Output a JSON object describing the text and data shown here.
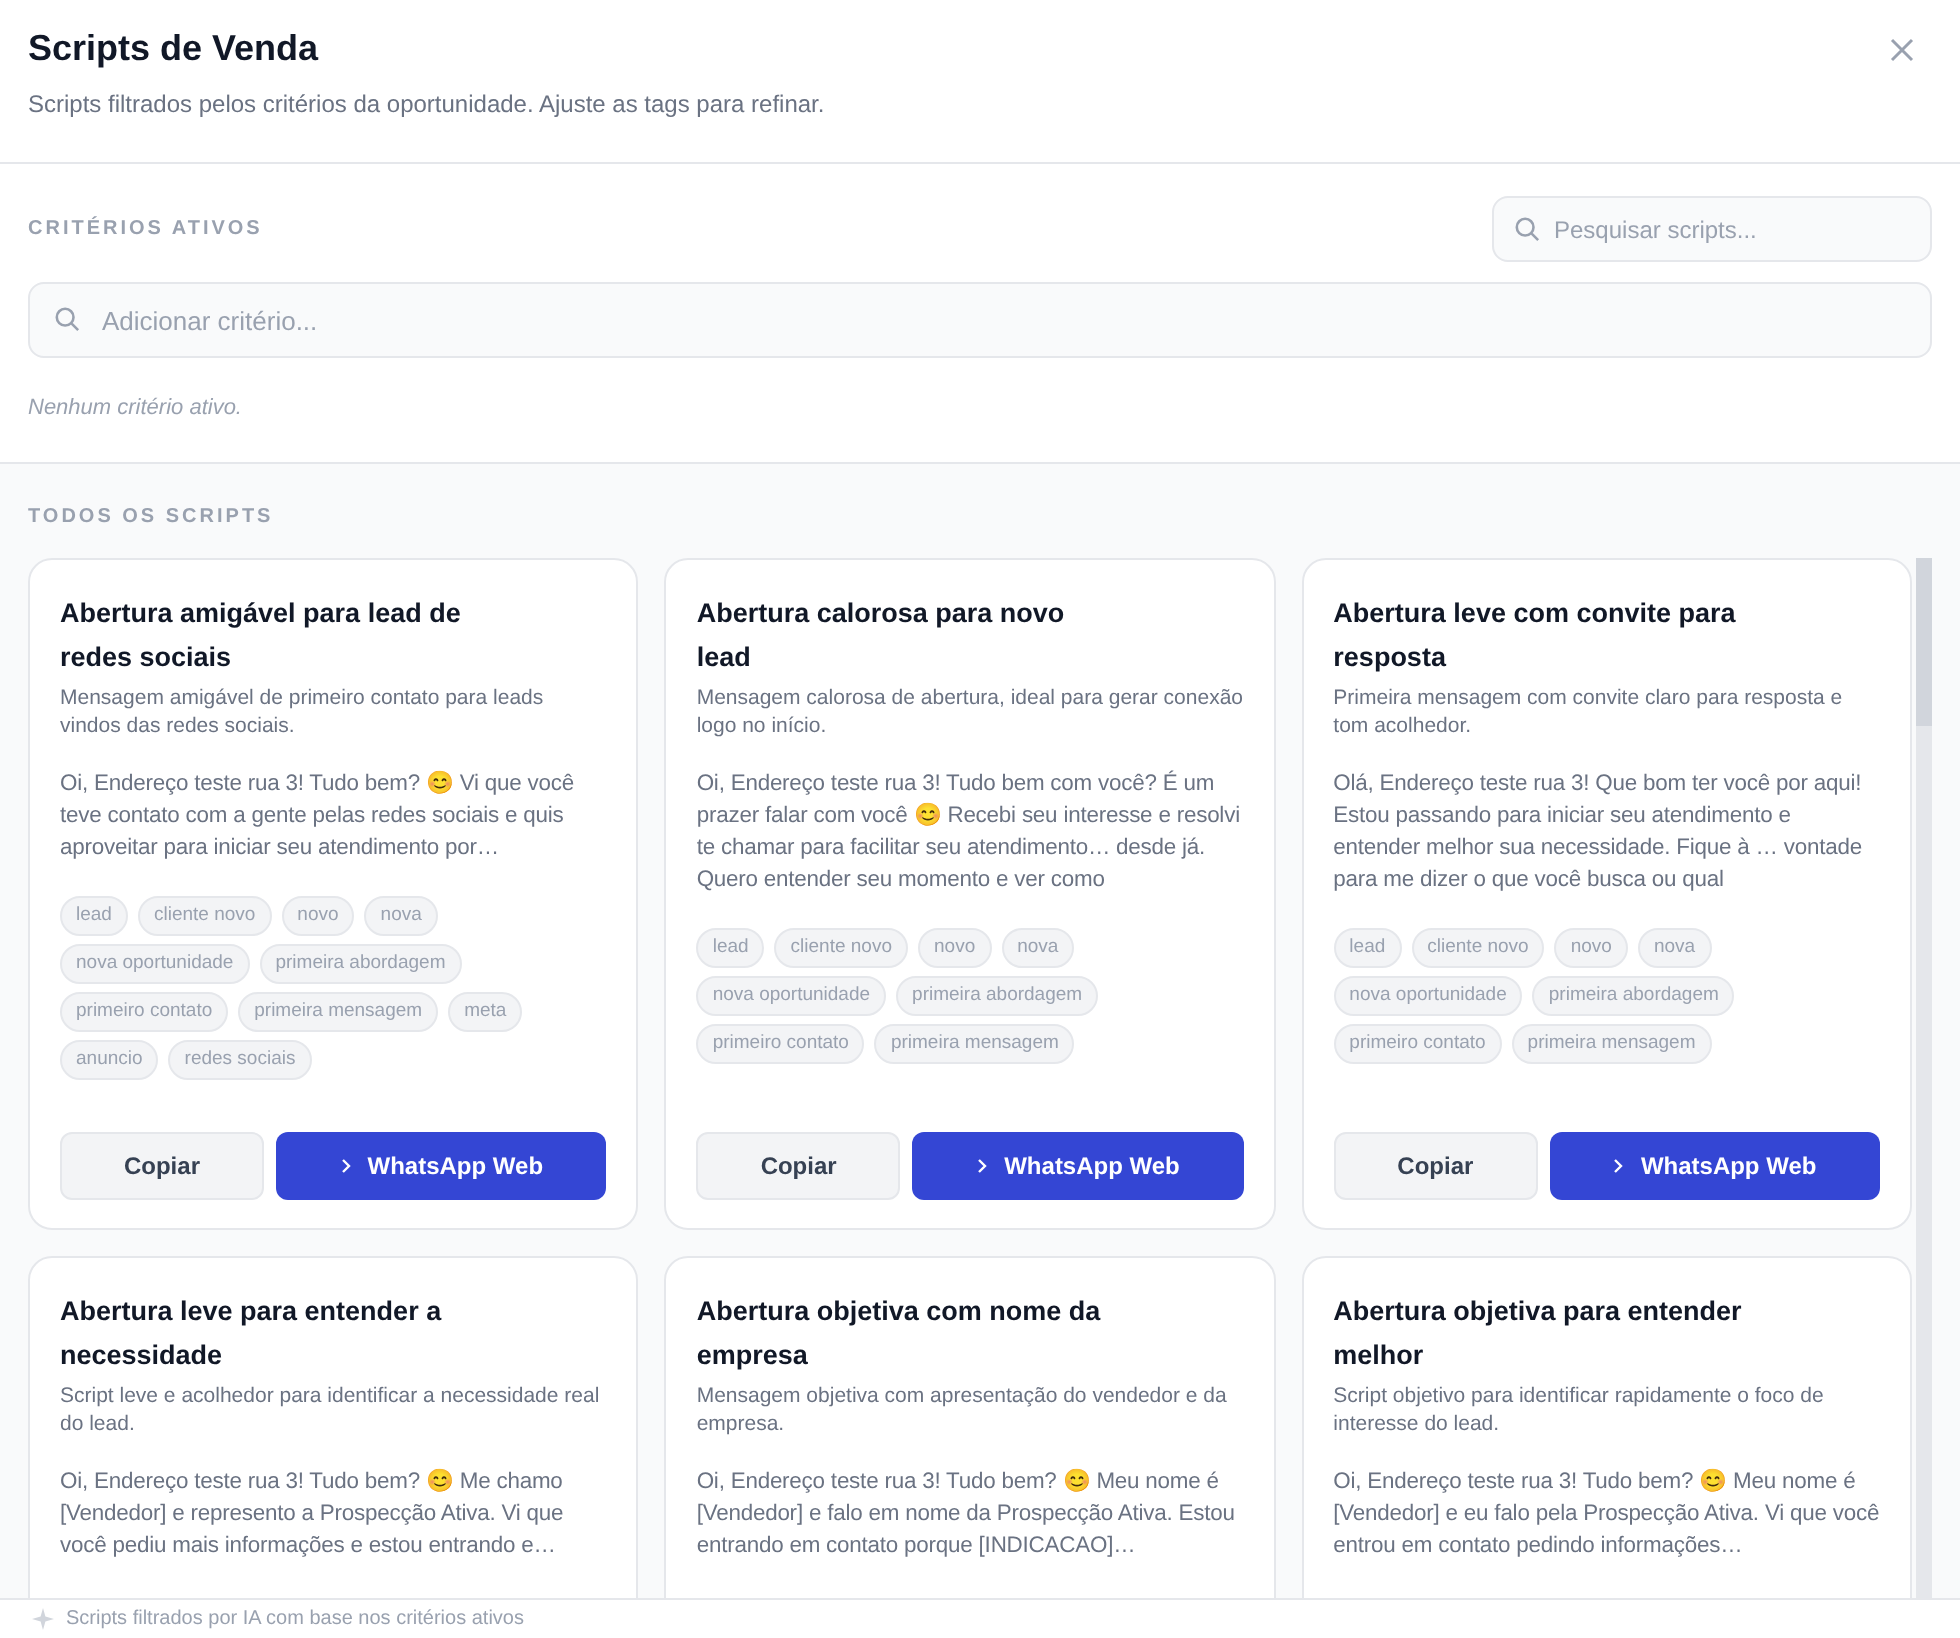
{
  "dialog": {
    "title": "Scripts de Venda",
    "subtitle": "Scripts filtrados pelos critérios da oportunidade. Ajuste as tags para refinar."
  },
  "criteria": {
    "heading": "CRITÉRIOS ATIVOS",
    "search_placeholder": "Pesquisar scripts...",
    "add_placeholder": "Adicionar critério...",
    "empty_text": "Nenhum critério ativo."
  },
  "scripts_heading": "TODOS OS SCRIPTS",
  "scripts": [
    {
      "title": "Abertura amigável para lead de redes sociais",
      "description": "Mensagem amigável de primeiro contato para leads vindos das redes sociais.",
      "message": "Oi, Endereço teste rua 3! Tudo bem? 😊 Vi que você teve contato com a gente pelas redes sociais e quis aproveitar para iniciar seu atendimento por…",
      "tags": [
        "lead",
        "cliente novo",
        "novo",
        "nova",
        "nova oportunidade",
        "primeira abordagem",
        "primeiro contato",
        "primeira mensagem",
        "meta",
        "anuncio",
        "redes sociais"
      ],
      "copy_label": "Copiar",
      "whatsapp_label": "WhatsApp Web"
    },
    {
      "title": "Abertura calorosa para novo lead",
      "description": "Mensagem calorosa de abertura, ideal para gerar conexão logo no início.",
      "message": "Oi, Endereço teste rua 3! Tudo bem com você? É um prazer falar com você 😊 Recebi seu interesse e resolvi te chamar para facilitar seu atendimento… desde já. Quero entender seu momento e ver como",
      "tags": [
        "lead",
        "cliente novo",
        "novo",
        "nova",
        "nova oportunidade",
        "primeira abordagem",
        "primeiro contato",
        "primeira mensagem"
      ],
      "copy_label": "Copiar",
      "whatsapp_label": "WhatsApp Web"
    },
    {
      "title": "Abertura leve com convite para resposta",
      "description": "Primeira mensagem com convite claro para resposta e tom acolhedor.",
      "message": "Olá, Endereço teste rua 3! Que bom ter você por aqui! Estou passando para iniciar seu atendimento e entender melhor sua necessidade. Fique à … vontade para me dizer o que você busca ou qual",
      "tags": [
        "lead",
        "cliente novo",
        "novo",
        "nova",
        "nova oportunidade",
        "primeira abordagem",
        "primeiro contato",
        "primeira mensagem"
      ],
      "copy_label": "Copiar",
      "whatsapp_label": "WhatsApp Web"
    },
    {
      "title": "Abertura leve para entender a necessidade",
      "description": "Script leve e acolhedor para identificar a necessidade real do lead.",
      "message": "Oi, Endereço teste rua 3! Tudo bem? 😊 Me chamo [Vendedor] e represento a Prospecção Ativa. Vi que você pediu mais informações e estou entrando e…"
    },
    {
      "title": "Abertura objetiva com nome da empresa",
      "description": "Mensagem objetiva com apresentação do vendedor e da empresa.",
      "message": "Oi, Endereço teste rua 3! Tudo bem? 😊 Meu nome é [Vendedor] e falo em nome da Prospecção Ativa. Estou entrando em contato porque [INDICACAO]…"
    },
    {
      "title": "Abertura objetiva para entender melhor",
      "description": "Script objetivo para identificar rapidamente o foco de interesse do lead.",
      "message": "Oi, Endereço teste rua 3! Tudo bem? 😊 Meu nome é [Vendedor] e eu falo pela Prospecção Ativa. Vi que você entrou em contato pedindo informações…"
    }
  ],
  "footer": "Scripts filtrados por IA com base nos critérios ativos"
}
